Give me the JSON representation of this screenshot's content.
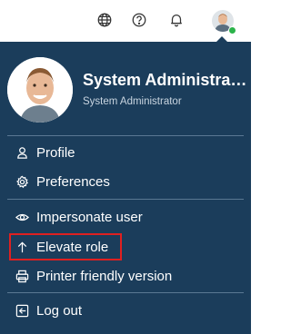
{
  "header": {
    "icons": [
      "globe-icon",
      "help-icon",
      "bell-icon"
    ],
    "status_color": "#2bb34a"
  },
  "profile": {
    "name": "System Administra…",
    "role": "System Administrator"
  },
  "menu": {
    "items": [
      {
        "label": "Profile",
        "icon": "user-icon"
      },
      {
        "label": "Preferences",
        "icon": "gear-icon"
      },
      {
        "label": "Impersonate user",
        "icon": "eye-icon"
      },
      {
        "label": "Elevate role",
        "icon": "arrow-up-icon",
        "highlighted": true
      },
      {
        "label": "Printer friendly version",
        "icon": "printer-icon"
      },
      {
        "label": "Log out",
        "icon": "logout-icon"
      }
    ]
  },
  "colors": {
    "panel": "#1b3d5b",
    "highlight": "#e02020",
    "text": "#ffffff"
  }
}
